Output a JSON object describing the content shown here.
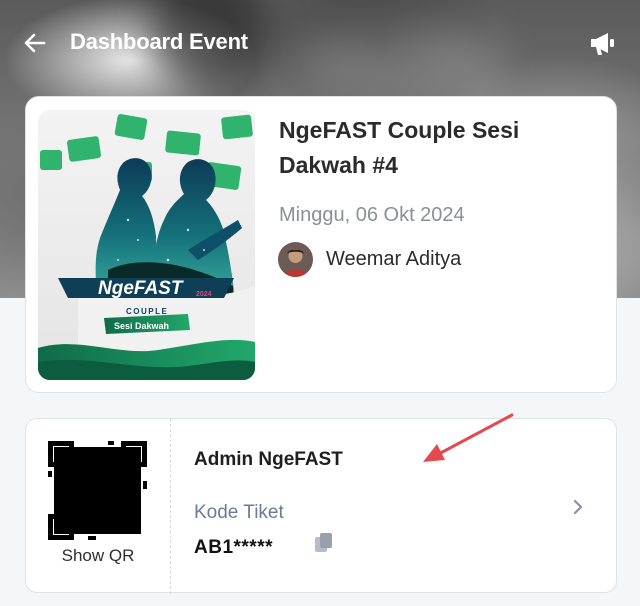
{
  "header": {
    "title": "Dashboard Event",
    "back_icon": "arrow-left-icon",
    "action_icon": "megaphone-icon"
  },
  "event": {
    "title": "NgeFAST Couple Sesi Dakwah #4",
    "date": "Minggu, 06 Okt 2024",
    "host_name": "Weemar Aditya",
    "poster": {
      "brand": "NgeFAST",
      "year": "2024",
      "tagline": "COUPLE",
      "subtitle": "Sesi Dakwah"
    }
  },
  "ticket": {
    "owner": "Admin NgeFAST",
    "qr_label": "Show QR",
    "code_label": "Kode Tiket",
    "code_value": "AB1*****",
    "copy_icon": "copy-icon",
    "chevron_icon": "chevron-right-icon"
  },
  "colors": {
    "accent_green": "#1e9e5a",
    "poster_teal": "#0b5e61",
    "muted_text": "#8b8f96",
    "code_label": "#6b7a99",
    "annotation_red": "#e5484d"
  }
}
